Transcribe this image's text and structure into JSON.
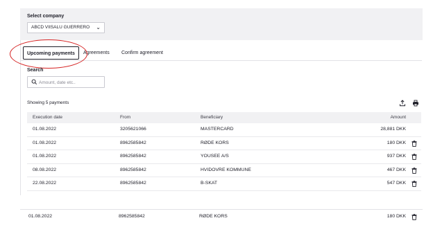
{
  "company": {
    "label": "Select company",
    "selected": "ABCD VIISALU GUERRERO"
  },
  "tabs": [
    {
      "label": "Upcoming payments",
      "active": true
    },
    {
      "label": "Agreements",
      "active": false
    },
    {
      "label": "Confirm agreement",
      "active": false
    }
  ],
  "search": {
    "label": "Search",
    "placeholder": "Amount, date etc.."
  },
  "showing": "Showing 5 payments",
  "table": {
    "headers": {
      "date": "Execution date",
      "from": "From",
      "beneficiary": "Beneficiary",
      "amount": "Amount"
    },
    "rows": [
      {
        "date": "01.08.2022",
        "from": "3205621066",
        "beneficiary": "MASTERCARD",
        "amount": "28,881 DKK",
        "deletable": false
      },
      {
        "date": "01.08.2022",
        "from": "8962585842",
        "beneficiary": "RØDE KORS",
        "amount": "180 DKK",
        "deletable": true
      },
      {
        "date": "01.08.2022",
        "from": "8962585842",
        "beneficiary": "YOUSEE A/S",
        "amount": "937 DKK",
        "deletable": true
      },
      {
        "date": "08.08.2022",
        "from": "8962585842",
        "beneficiary": "HVIDOVRE KOMMUNE",
        "amount": "467 DKK",
        "deletable": true
      },
      {
        "date": "22.08.2022",
        "from": "8962585842",
        "beneficiary": "B-SKAT",
        "amount": "547 DKK",
        "deletable": true
      }
    ]
  },
  "highlighted_row": {
    "date": "01.08.2022",
    "from": "8962585842",
    "beneficiary": "RØDE KORS",
    "amount": "180 DKK"
  },
  "icons": [
    "chevron-down-icon",
    "search-icon",
    "export-icon",
    "print-icon",
    "trash-icon"
  ],
  "colors": {
    "annotation": "#d52020",
    "panel": "#f1f1f3",
    "text": "#1e1e28"
  }
}
